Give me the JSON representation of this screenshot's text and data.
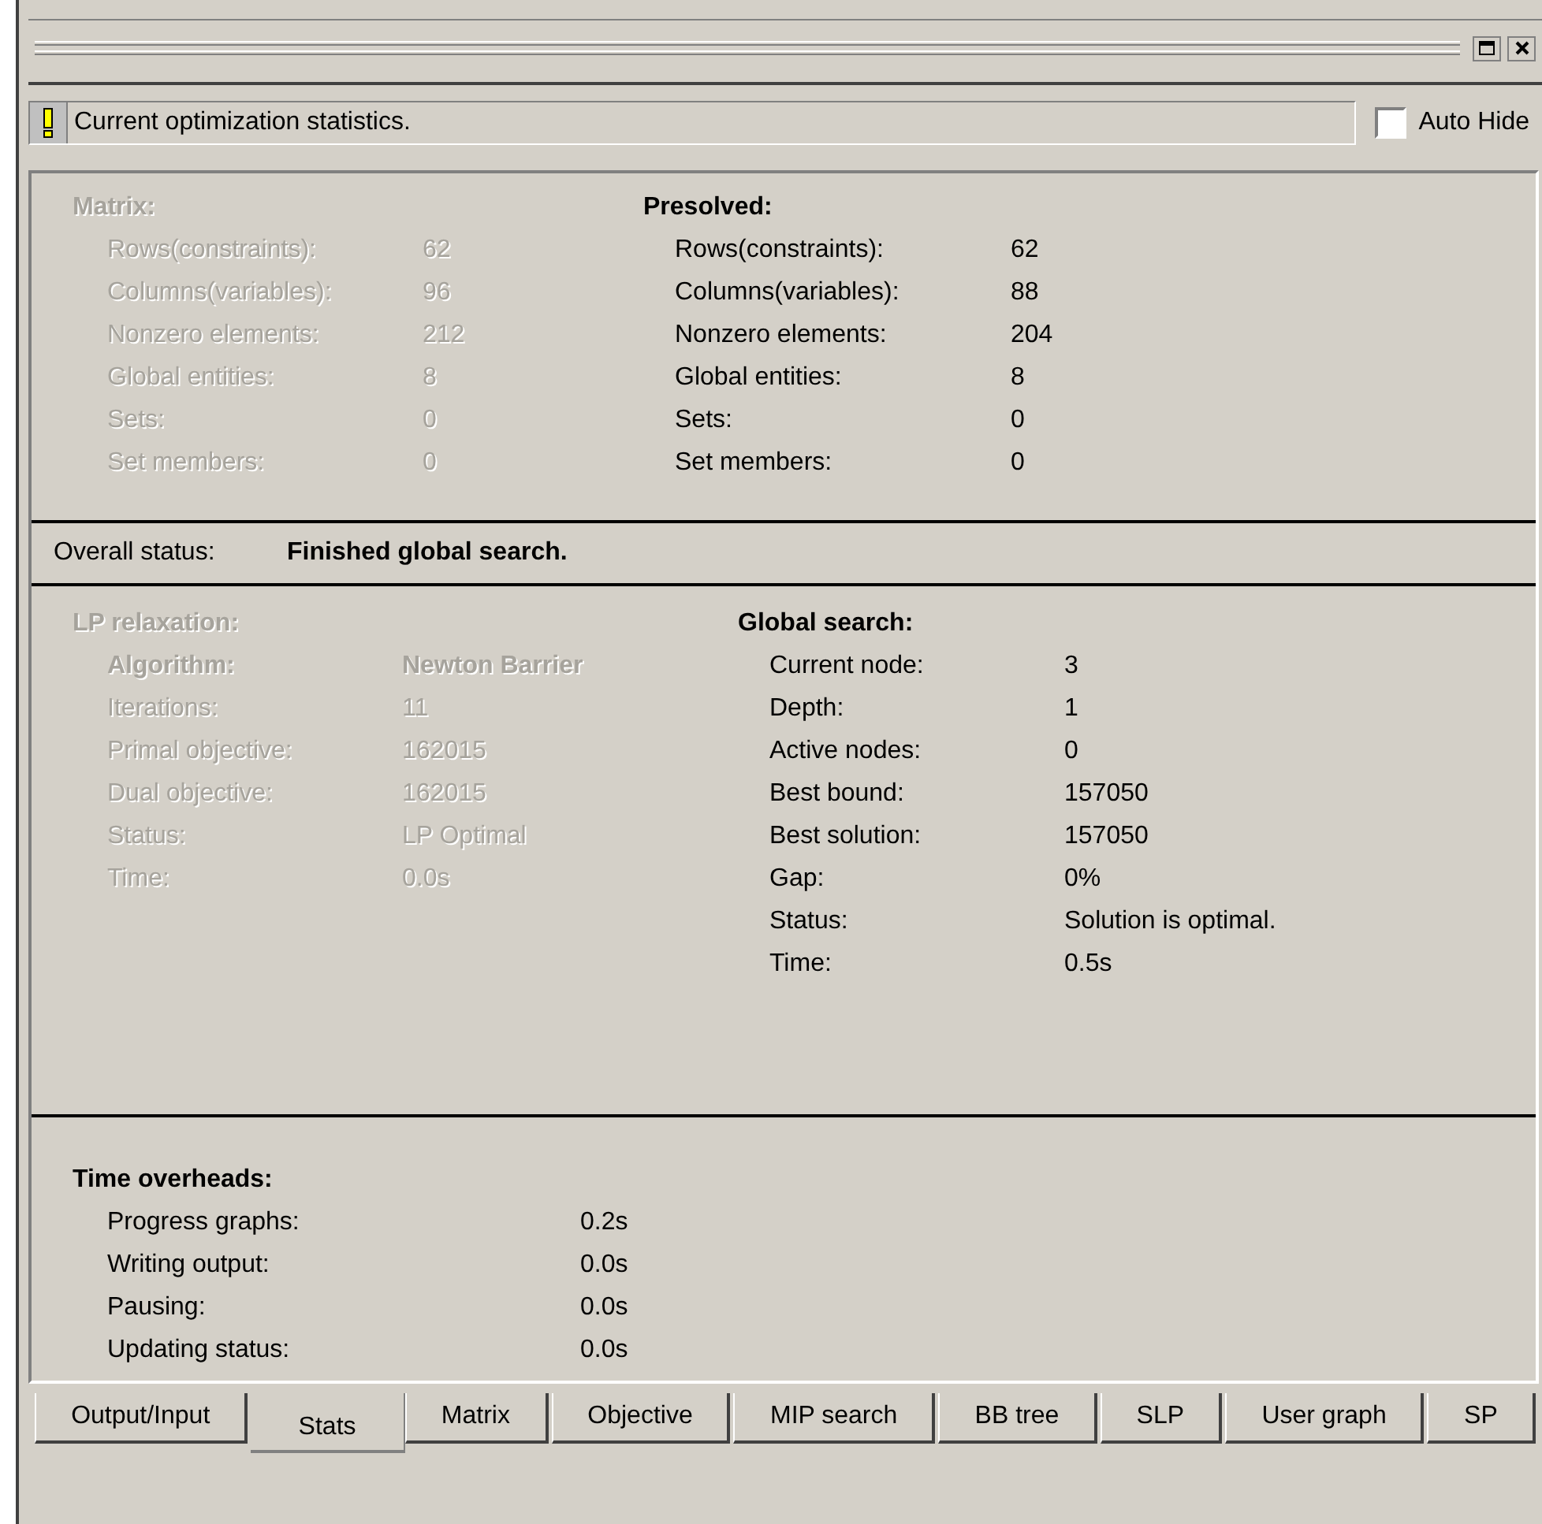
{
  "info_bar": {
    "message": "Current optimization statistics.",
    "auto_hide": {
      "label": "Auto Hide",
      "checked": false
    }
  },
  "matrix": {
    "title": "Matrix:",
    "disabled": true,
    "rows": [
      {
        "label": "Rows(constraints):",
        "value": "62"
      },
      {
        "label": "Columns(variables):",
        "value": "96"
      },
      {
        "label": "Nonzero elements:",
        "value": "212"
      },
      {
        "label": "Global entities:",
        "value": "8"
      },
      {
        "label": "Sets:",
        "value": "0"
      },
      {
        "label": "Set members:",
        "value": "0"
      }
    ]
  },
  "presolved": {
    "title": "Presolved:",
    "disabled": false,
    "rows": [
      {
        "label": "Rows(constraints):",
        "value": "62"
      },
      {
        "label": "Columns(variables):",
        "value": "88"
      },
      {
        "label": "Nonzero elements:",
        "value": "204"
      },
      {
        "label": "Global entities:",
        "value": "8"
      },
      {
        "label": "Sets:",
        "value": "0"
      },
      {
        "label": "Set members:",
        "value": "0"
      }
    ]
  },
  "overall_status": {
    "label": "Overall status:",
    "value": "Finished global search."
  },
  "lp_relaxation": {
    "title": "LP relaxation:",
    "disabled": true,
    "rows": [
      {
        "kind": "header",
        "label": "Algorithm:",
        "value": "Newton Barrier"
      },
      {
        "kind": "plain",
        "label": "Iterations:",
        "value": "11"
      },
      {
        "kind": "plain",
        "label": "Primal objective:",
        "value": "162015"
      },
      {
        "kind": "plain",
        "label": "Dual objective:",
        "value": "162015"
      },
      {
        "kind": "plain",
        "label": "Status:",
        "value": "LP Optimal"
      },
      {
        "kind": "plain",
        "label": "Time:",
        "value": "0.0s"
      }
    ]
  },
  "global_search": {
    "title": "Global search:",
    "disabled": false,
    "rows": [
      {
        "label": "Current node:",
        "value": "3"
      },
      {
        "label": "Depth:",
        "value": "1"
      },
      {
        "label": "Active nodes:",
        "value": "0"
      },
      {
        "label": "Best bound:",
        "value": "157050"
      },
      {
        "label": "Best solution:",
        "value": "157050"
      },
      {
        "label": "Gap:",
        "value": "0%"
      },
      {
        "label": "Status:",
        "value": "Solution is optimal."
      },
      {
        "label": "Time:",
        "value": "0.5s"
      }
    ]
  },
  "time_overheads": {
    "title": "Time overheads:",
    "disabled": false,
    "rows": [
      {
        "label": "Progress graphs:",
        "value": "0.2s"
      },
      {
        "label": "Writing output:",
        "value": "0.0s"
      },
      {
        "label": "Pausing:",
        "value": "0.0s"
      },
      {
        "label": "Updating status:",
        "value": "0.0s"
      }
    ]
  },
  "tabs": [
    {
      "label": "Output/Input",
      "selected": false
    },
    {
      "label": "Stats",
      "selected": true
    },
    {
      "label": "Matrix",
      "selected": false
    },
    {
      "label": "Objective",
      "selected": false
    },
    {
      "label": "MIP search",
      "selected": false
    },
    {
      "label": "BB tree",
      "selected": false
    },
    {
      "label": "SLP",
      "selected": false
    },
    {
      "label": "User graph",
      "selected": false
    },
    {
      "label": "SP",
      "selected": false
    }
  ]
}
